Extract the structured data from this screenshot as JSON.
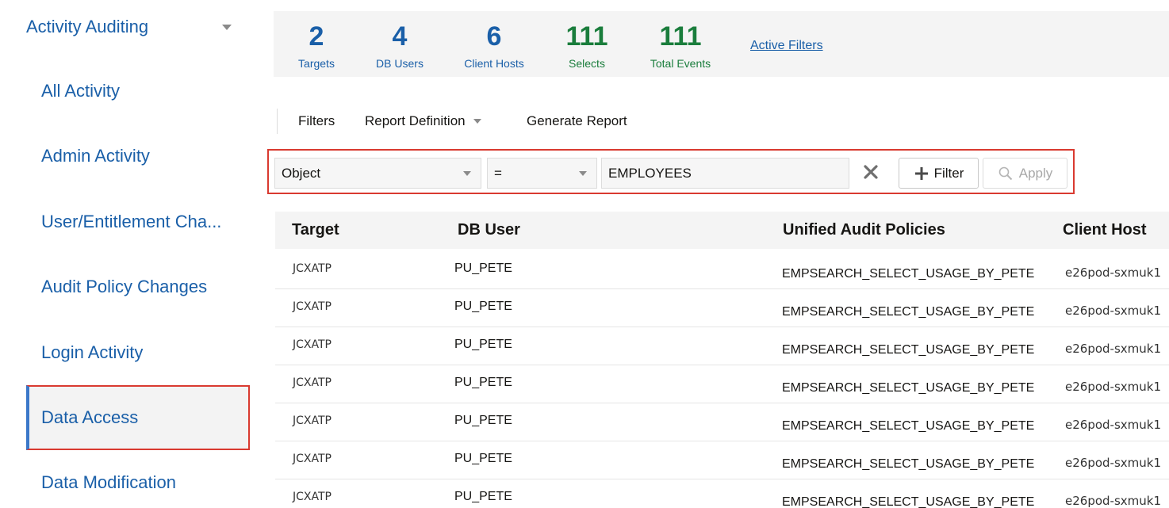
{
  "sidebar": {
    "group_label": "Activity Auditing",
    "items": [
      {
        "label": "All Activity"
      },
      {
        "label": "Admin Activity"
      },
      {
        "label": "User/Entitlement Cha..."
      },
      {
        "label": "Audit Policy Changes"
      },
      {
        "label": "Login Activity"
      },
      {
        "label": "Data Access",
        "selected": true
      },
      {
        "label": "Data Modification"
      }
    ]
  },
  "summary": {
    "targets": {
      "value": "2",
      "label": "Targets"
    },
    "db_users": {
      "value": "4",
      "label": "DB Users"
    },
    "client_hosts": {
      "value": "6",
      "label": "Client Hosts"
    },
    "selects": {
      "value": "111",
      "label": "Selects"
    },
    "total_events": {
      "value": "111",
      "label": "Total Events"
    },
    "active_filters_link": "Active Filters"
  },
  "toolbar": {
    "filters_label": "Filters",
    "report_definition_label": "Report Definition",
    "generate_report_label": "Generate Report"
  },
  "filter": {
    "field_value": "Object",
    "operator_value": "=",
    "text_value": "EMPLOYEES",
    "filter_button_label": "Filter",
    "apply_button_label": "Apply"
  },
  "table": {
    "headers": {
      "target": "Target",
      "db_user": "DB User",
      "policies": "Unified Audit Policies",
      "client_host": "Client Host"
    },
    "rows": [
      {
        "target": "JCXATP",
        "db_user": "PU_PETE",
        "policies": "EMPSEARCH_SELECT_USAGE_BY_PETE",
        "client_host": "e26pod-sxmuk1"
      },
      {
        "target": "JCXATP",
        "db_user": "PU_PETE",
        "policies": "EMPSEARCH_SELECT_USAGE_BY_PETE",
        "client_host": "e26pod-sxmuk1"
      },
      {
        "target": "JCXATP",
        "db_user": "PU_PETE",
        "policies": "EMPSEARCH_SELECT_USAGE_BY_PETE",
        "client_host": "e26pod-sxmuk1"
      },
      {
        "target": "JCXATP",
        "db_user": "PU_PETE",
        "policies": "EMPSEARCH_SELECT_USAGE_BY_PETE",
        "client_host": "e26pod-sxmuk1"
      },
      {
        "target": "JCXATP",
        "db_user": "PU_PETE",
        "policies": "EMPSEARCH_SELECT_USAGE_BY_PETE",
        "client_host": "e26pod-sxmuk1"
      },
      {
        "target": "JCXATP",
        "db_user": "PU_PETE",
        "policies": "EMPSEARCH_SELECT_USAGE_BY_PETE",
        "client_host": "e26pod-sxmuk1"
      },
      {
        "target": "JCXATP",
        "db_user": "PU_PETE",
        "policies": "EMPSEARCH_SELECT_USAGE_BY_PETE",
        "client_host": "e26pod-sxmuk1"
      }
    ]
  },
  "colors": {
    "link_blue": "#1a5fa8",
    "metric_green": "#1a7d3c",
    "highlight_red": "#d93a30"
  }
}
